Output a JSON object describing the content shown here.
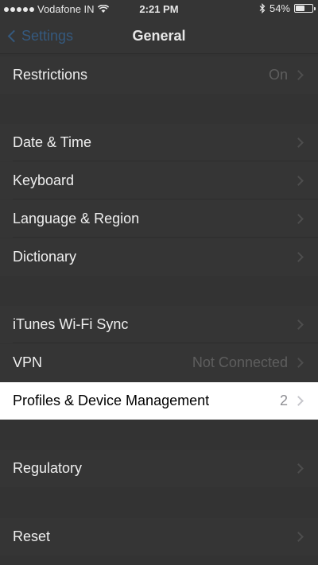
{
  "status_bar": {
    "carrier": "Vodafone IN",
    "time": "2:21 PM",
    "battery_percent": "54%",
    "battery_level": 0.54,
    "icons": [
      "signal-dots-icon",
      "wifi-icon",
      "bluetooth-icon",
      "battery-icon"
    ]
  },
  "nav": {
    "back_label": "Settings",
    "title": "General"
  },
  "rows": {
    "restrictions": {
      "label": "Restrictions",
      "value": "On"
    },
    "date_time": {
      "label": "Date & Time"
    },
    "keyboard": {
      "label": "Keyboard"
    },
    "language_region": {
      "label": "Language & Region"
    },
    "dictionary": {
      "label": "Dictionary"
    },
    "itunes_sync": {
      "label": "iTunes Wi-Fi Sync"
    },
    "vpn": {
      "label": "VPN",
      "value": "Not Connected"
    },
    "profiles": {
      "label": "Profiles & Device Management",
      "value": "2"
    },
    "regulatory": {
      "label": "Regulatory"
    },
    "reset": {
      "label": "Reset"
    }
  },
  "colors": {
    "dim_background": "#333333",
    "highlight_row": "#ffffff",
    "accent_dimmed": "#35597e"
  }
}
